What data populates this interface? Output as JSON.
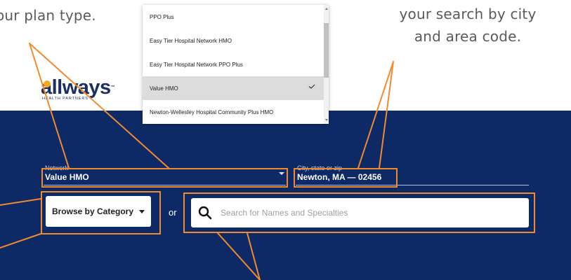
{
  "callouts": {
    "left": "our plan type.",
    "right_line1": "your search by city",
    "right_line2": "and area code."
  },
  "logo": {
    "name": "allways",
    "subtitle": "HEALTH PARTNERS"
  },
  "network": {
    "label": "Network",
    "value": "Value HMO"
  },
  "location": {
    "label": "City, state or zip",
    "value": "Newton, MA — 02456"
  },
  "browse": {
    "label": "Browse by Category"
  },
  "or_text": "or",
  "search": {
    "placeholder": "Search for Names and Specialties"
  },
  "dropdown": {
    "options": [
      "PPO Plus",
      "Easy Tier Hospital Network HMO",
      "Easy Tier Hospital Network PPO Plus",
      "Value HMO",
      "Newton-Wellesley Hospital Community Plus HMO"
    ],
    "selected": "Value HMO"
  },
  "colors": {
    "banner": "#0d2a67",
    "annotation": "#f28a2d",
    "logo_accent": "#f5a623"
  }
}
